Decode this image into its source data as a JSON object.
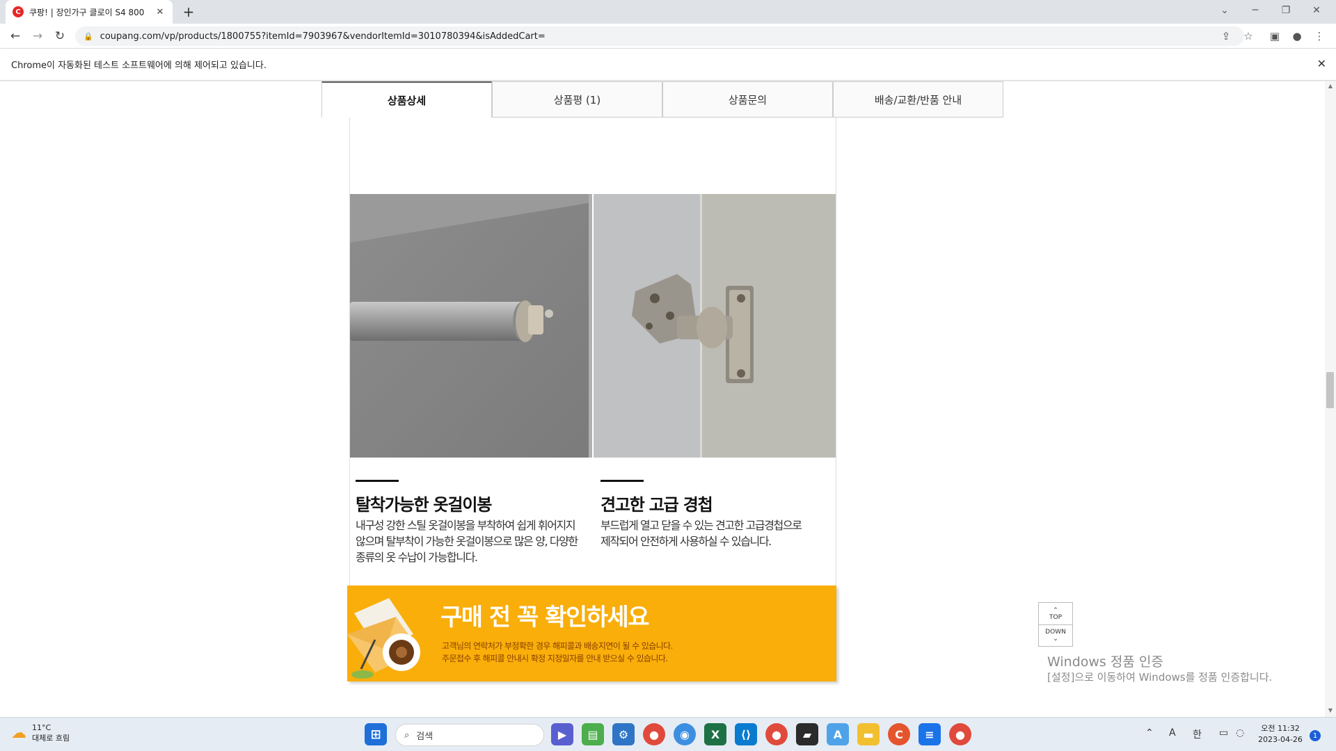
{
  "browser": {
    "tab_title": "쿠팡! | 장인가구 클로이 S4 800",
    "tab_favicon": "C",
    "url": "coupang.com/vp/products/1800755?itemId=7903967&vendorItemId=3010780394&isAddedCart=",
    "infobar_text": "Chrome이 자동화된 테스트 소프트웨어에 의해 제어되고 있습니다."
  },
  "product_tabs": [
    {
      "label": "상품상세"
    },
    {
      "label": "상품평 (1)"
    },
    {
      "label": "상품문의"
    },
    {
      "label": "배송/교환/반품 안내"
    }
  ],
  "features": [
    {
      "title": "탈착가능한 옷걸이봉",
      "lines": [
        "내구성 강한 스틸 옷걸이봉을 부착하여 쉽게 휘어지지",
        "않으며 탈부착이 가능한 옷걸이봉으로 많은 양, 다양한",
        "종류의 옷 수납이 가능합니다."
      ]
    },
    {
      "title": "견고한 고급 경첩",
      "lines": [
        "부드럽게 열고 닫을 수 있는 견고한 고급경첩으로",
        "제작되어 안전하게 사용하실 수 있습니다."
      ]
    }
  ],
  "notice_banner": {
    "title": "구매 전 꼭 확인하세요",
    "lines": [
      "고객님의 연락처가 부정확한 경우 해피콜과 배송지연이 될 수 있습니다.",
      "주문접수 후 해피콜 안내시 확정 지정일자를 안내 받으실 수 있습니다."
    ]
  },
  "scroll_buttons": {
    "top": "TOP",
    "down": "DOWN"
  },
  "watermark": {
    "title": "Windows 정품 인증",
    "subtitle": "[설정]으로 이동하여 Windows를 정품 인증합니다."
  },
  "taskbar": {
    "weather_temp": "11°C",
    "weather_desc": "대체로 흐림",
    "search_placeholder": "검색",
    "ime_mode": "A",
    "ime_lang": "한",
    "time": "오전 11:32",
    "date": "2023-04-26",
    "notification_count": "1"
  }
}
